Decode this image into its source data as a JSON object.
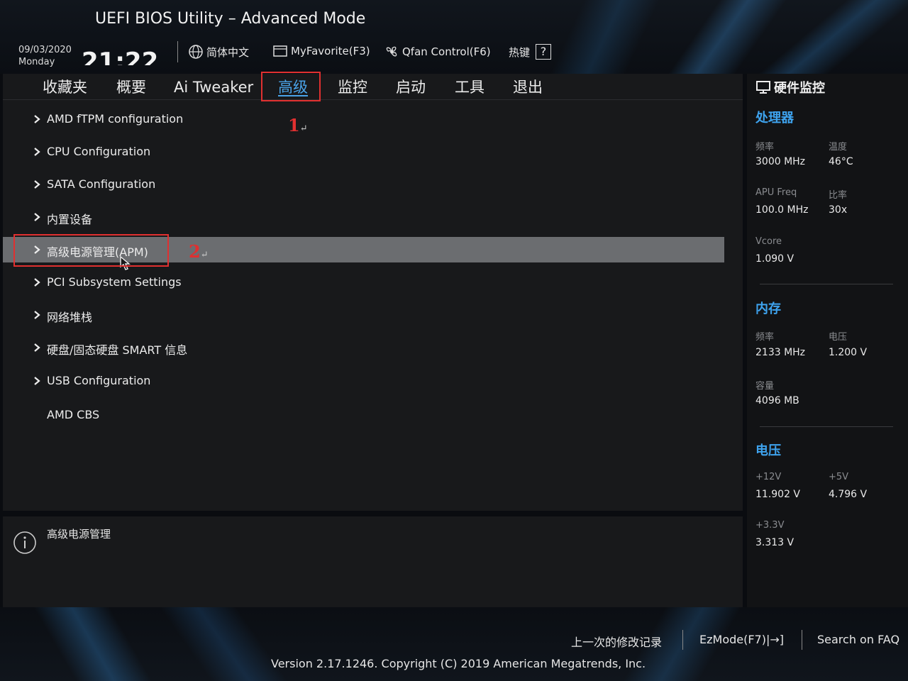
{
  "header": {
    "title": "UEFI BIOS Utility – Advanced Mode",
    "date": "09/03/2020",
    "weekday": "Monday",
    "time": "21:22",
    "language_label": "简体中文",
    "myfavorite_label": "MyFavorite(F3)",
    "qfan_label": "Qfan Control(F6)",
    "hotkey_label": "热键",
    "hotkey_key": "?"
  },
  "tabs": [
    {
      "label": "收藏夹"
    },
    {
      "label": "概要"
    },
    {
      "label": "Ai Tweaker"
    },
    {
      "label": "高级"
    },
    {
      "label": "监控"
    },
    {
      "label": "启动"
    },
    {
      "label": "工具"
    },
    {
      "label": "退出"
    }
  ],
  "active_tab_index": 3,
  "menu": {
    "items": [
      {
        "label": "AMD fTPM configuration",
        "submenu": true
      },
      {
        "label": "CPU Configuration",
        "submenu": true
      },
      {
        "label": "SATA Configuration",
        "submenu": true
      },
      {
        "label": "内置设备",
        "submenu": true
      },
      {
        "label": "高级电源管理(APM)",
        "submenu": true,
        "selected": true
      },
      {
        "label": "PCI Subsystem Settings",
        "submenu": true
      },
      {
        "label": "网络堆栈",
        "submenu": true
      },
      {
        "label": "硬盘/固态硬盘 SMART 信息",
        "submenu": true
      },
      {
        "label": "USB Configuration",
        "submenu": true
      },
      {
        "label": "AMD CBS",
        "submenu": false
      }
    ]
  },
  "annotations": {
    "step1": "1",
    "step2": "2",
    "return_mark": "↵",
    "color": "#e03030"
  },
  "help": {
    "text": "高级电源管理"
  },
  "hw_monitor": {
    "title": "硬件监控",
    "cpu": {
      "title": "处理器",
      "freq_label": "频率",
      "freq_value": "3000 MHz",
      "temp_label": "温度",
      "temp_value": "46°C",
      "apu_label": "APU Freq",
      "apu_value": "100.0 MHz",
      "ratio_label": "比率",
      "ratio_value": "30x",
      "vcore_label": "Vcore",
      "vcore_value": "1.090 V"
    },
    "memory": {
      "title": "内存",
      "freq_label": "频率",
      "freq_value": "2133 MHz",
      "volt_label": "电压",
      "volt_value": "1.200 V",
      "cap_label": "容量",
      "cap_value": "4096 MB"
    },
    "voltage": {
      "title": "电压",
      "v12_label": "+12V",
      "v12_value": "11.902 V",
      "v5_label": "+5V",
      "v5_value": "4.796 V",
      "v33_label": "+3.3V",
      "v33_value": "3.313 V"
    }
  },
  "footer": {
    "last_modified": "上一次的修改记录",
    "ezmode": "EzMode(F7)|→]",
    "search": "Search on FAQ",
    "copyright": "Version 2.17.1246. Copyright (C) 2019 American Megatrends, Inc."
  },
  "colors": {
    "accent": "#3ea3ee",
    "highlight_box": "#e03030",
    "selected_row": "#6b6d70",
    "panel": "#18191b"
  }
}
